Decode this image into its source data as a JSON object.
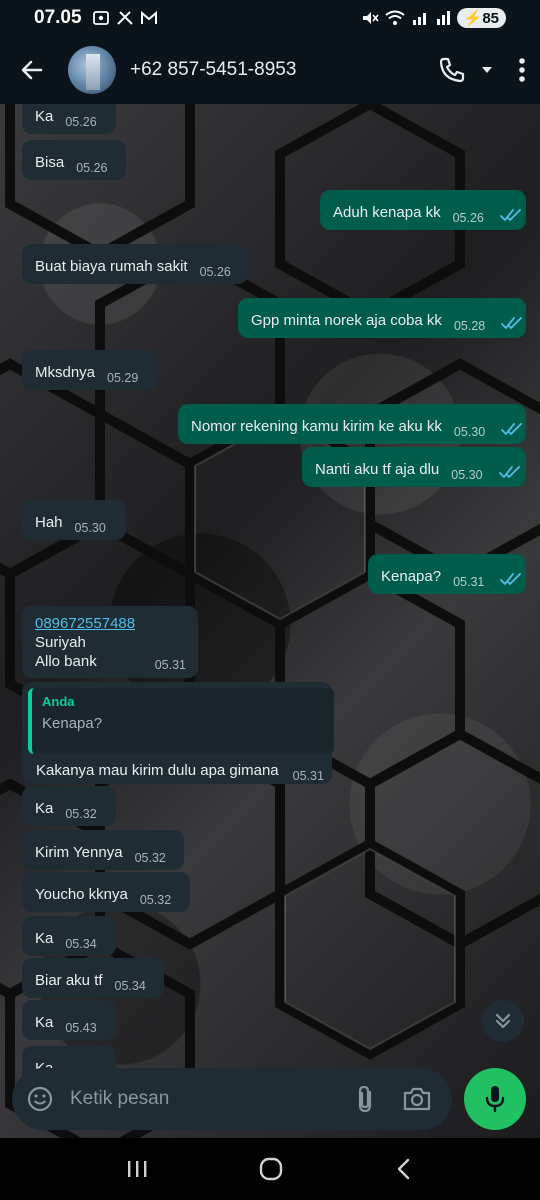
{
  "status_bar": {
    "time": "07.05",
    "battery": "85"
  },
  "header": {
    "contact": "+62 857-5451-8953"
  },
  "messages": [
    {
      "dir": "in",
      "text": "Ka",
      "time": "05.26"
    },
    {
      "dir": "in",
      "text": "Bisa",
      "time": "05.26"
    },
    {
      "dir": "out",
      "text": "Aduh kenapa kk",
      "time": "05.26"
    },
    {
      "dir": "in",
      "text": "Buat biaya rumah sakit",
      "time": "05.26"
    },
    {
      "dir": "out",
      "text": "Gpp minta norek aja coba kk",
      "time": "05.28"
    },
    {
      "dir": "in",
      "text": "Mksdnya",
      "time": "05.29"
    },
    {
      "dir": "out",
      "text": "Nomor rekening kamu kirim ke aku kk",
      "time": "05.30"
    },
    {
      "dir": "out",
      "text": "Nanti aku tf aja dlu",
      "time": "05.30"
    },
    {
      "dir": "in",
      "text": "Hah",
      "time": "05.30"
    },
    {
      "dir": "out",
      "text": "Kenapa?",
      "time": "05.31"
    },
    {
      "dir": "in",
      "lines": [
        "089672557488",
        "Suriyah",
        "Allo bank"
      ],
      "time": "05.31"
    },
    {
      "dir": "in",
      "quote_author": "Anda",
      "quote_text": "Kenapa?",
      "text": "Kakanya mau kirim dulu apa gimana",
      "time": "05.31"
    },
    {
      "dir": "in",
      "text": "Ka",
      "time": "05.32"
    },
    {
      "dir": "in",
      "text": "Kirim Yennya",
      "time": "05.32"
    },
    {
      "dir": "in",
      "text": "Youcho kknya",
      "time": "05.32"
    },
    {
      "dir": "in",
      "text": "Ka",
      "time": "05.34"
    },
    {
      "dir": "in",
      "text": "Biar aku tf",
      "time": "05.34"
    },
    {
      "dir": "in",
      "text": "Ka",
      "time": "05.43"
    },
    {
      "dir": "in",
      "text": "Ka",
      "time": ""
    }
  ],
  "composer": {
    "placeholder": "Ketik pesan"
  },
  "colors": {
    "incoming_bubble": "#1f2c33",
    "outgoing_bubble": "#005c4b",
    "read_ticks": "#53bdeb",
    "mic_button": "#21c063"
  },
  "icons": [
    "back-arrow-icon",
    "phone-icon",
    "dropdown-icon",
    "more-options-icon",
    "emoji-icon",
    "attach-icon",
    "camera-icon",
    "mic-icon",
    "scroll-down-icon"
  ]
}
